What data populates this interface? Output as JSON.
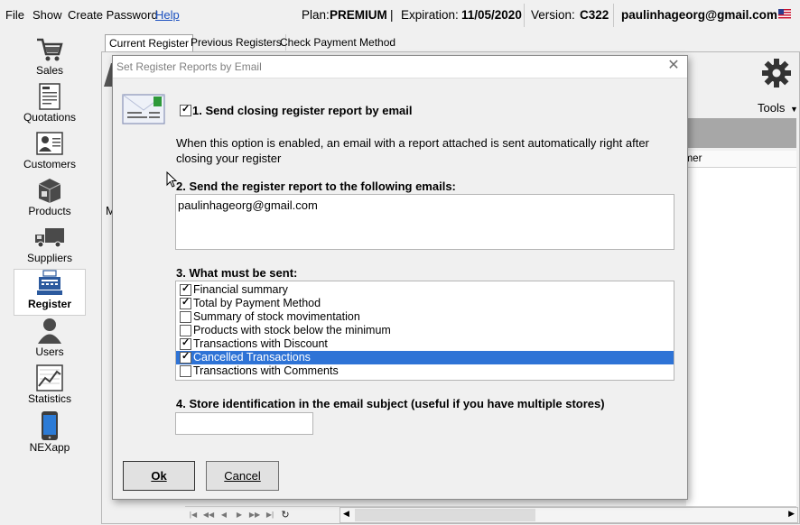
{
  "menu": {
    "file": "File",
    "show": "Show",
    "create_password": "Create Password",
    "help": "Help"
  },
  "status": {
    "plan_label": "Plan:",
    "plan_value": "PREMIUM",
    "divider": "|",
    "expiration_label": "Expiration:",
    "expiration_value": "11/05/2020",
    "version_label": "Version:",
    "version_value": "C322",
    "user_email": "paulinhageorg@gmail.com",
    "flag_icon": "us-flag-icon"
  },
  "sidebar": {
    "items": [
      {
        "label": "Sales",
        "icon": "shopping-cart-icon"
      },
      {
        "label": "Quotations",
        "icon": "quotation-document-icon"
      },
      {
        "label": "Customers",
        "icon": "customer-card-icon"
      },
      {
        "label": "Products",
        "icon": "product-box-icon"
      },
      {
        "label": "Suppliers",
        "icon": "delivery-truck-icon"
      },
      {
        "label": "Register",
        "icon": "cash-register-icon"
      },
      {
        "label": "Users",
        "icon": "user-icon"
      },
      {
        "label": "Statistics",
        "icon": "statistics-chart-icon"
      },
      {
        "label": "NEXapp",
        "icon": "smartphone-icon"
      }
    ],
    "active": "Register"
  },
  "tabs": [
    "Current Register",
    "Previous Registers",
    "Check Payment Method"
  ],
  "background": {
    "tools_label": "Tools",
    "customer_column_partial": "tomer",
    "partial_letter": "M"
  },
  "dialog": {
    "title": "Set Register Reports by Email",
    "section1_label": "1. Send closing register report by email",
    "section1_checked": true,
    "description": "When this option is enabled, an email with a report attached is sent automatically right after closing your register",
    "section2_label": "2. Send the register report to the following emails:",
    "emails": "paulinhageorg@gmail.com",
    "section3_label": "3. What must be sent:",
    "options": [
      {
        "label": "Financial summary",
        "checked": true,
        "selected": false
      },
      {
        "label": "Total by Payment Method",
        "checked": true,
        "selected": false
      },
      {
        "label": "Summary of stock movimentation",
        "checked": false,
        "selected": false
      },
      {
        "label": "Products with stock below the minimum",
        "checked": false,
        "selected": false
      },
      {
        "label": "Transactions with Discount",
        "checked": true,
        "selected": false
      },
      {
        "label": "Cancelled Transactions",
        "checked": true,
        "selected": true
      },
      {
        "label": "Transactions with Comments",
        "checked": false,
        "selected": false
      }
    ],
    "section4_label": "4. Store identification in the email subject (useful if you have multiple stores)",
    "store_id_value": "",
    "ok_label": "Ok",
    "cancel_label": "Cancel"
  },
  "colors": {
    "selection": "#2e73d6",
    "link": "#1a4fbf"
  }
}
